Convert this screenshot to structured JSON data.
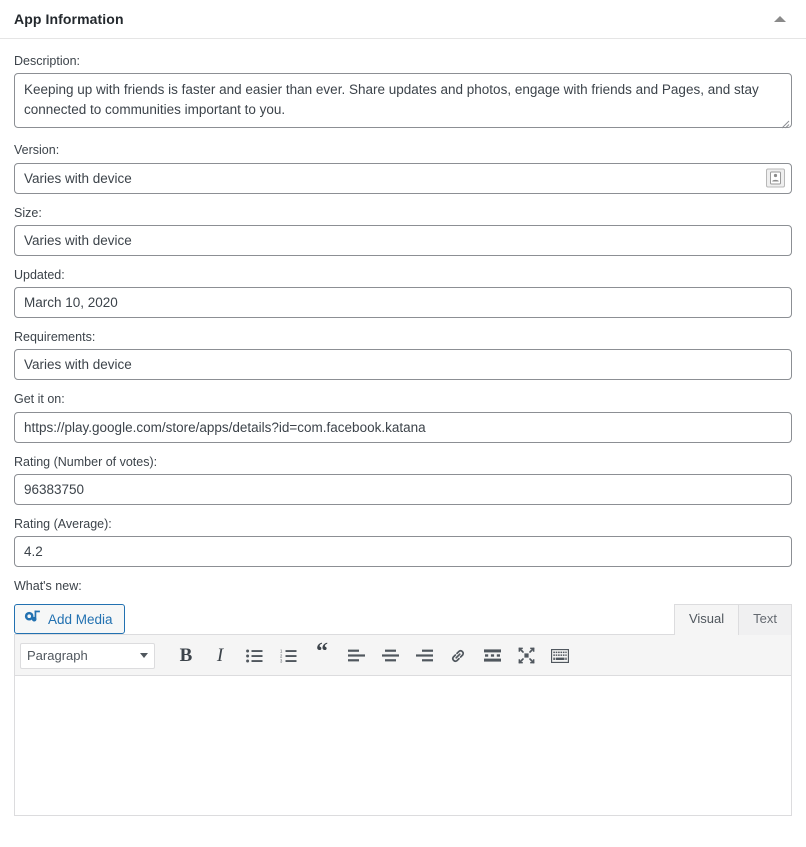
{
  "panel": {
    "title": "App Information",
    "toggle_icon": "caret-up-icon"
  },
  "fields": [
    {
      "key": "description",
      "label": "Description:",
      "type": "textarea",
      "value": "Keeping up with friends is faster and easier than ever. Share updates and photos, engage with friends and Pages, and stay connected to communities important to you."
    },
    {
      "key": "version",
      "label": "Version:",
      "type": "text",
      "value": "Varies with device",
      "trailing_icon": "autofill-card-icon"
    },
    {
      "key": "size",
      "label": "Size:",
      "type": "text",
      "value": "Varies with device"
    },
    {
      "key": "updated",
      "label": "Updated:",
      "type": "text",
      "value": "March 10, 2020"
    },
    {
      "key": "requirements",
      "label": "Requirements:",
      "type": "text",
      "value": "Varies with device"
    },
    {
      "key": "get_it_on",
      "label": "Get it on:",
      "type": "text",
      "value": "https://play.google.com/store/apps/details?id=com.facebook.katana"
    },
    {
      "key": "rating_votes",
      "label": "Rating (Number of votes):",
      "type": "text",
      "value": "96383750"
    },
    {
      "key": "rating_average",
      "label": "Rating (Average):",
      "type": "text",
      "value": "4.2"
    }
  ],
  "editor": {
    "label": "What's new:",
    "add_media_label": "Add Media",
    "add_media_icon": "media-camera-note-icon",
    "tabs": [
      {
        "label": "Visual",
        "active": true
      },
      {
        "label": "Text",
        "active": false
      }
    ],
    "format_select": {
      "value": "Paragraph",
      "caret_icon": "chevron-down-icon"
    },
    "toolbar_buttons": [
      {
        "name": "bold-button",
        "glyph": "B",
        "icon": "bold-icon"
      },
      {
        "name": "italic-button",
        "glyph": "I",
        "icon": "italic-icon"
      },
      {
        "name": "bulleted-list-button",
        "glyph": "",
        "icon": "bulleted-list-icon"
      },
      {
        "name": "numbered-list-button",
        "glyph": "",
        "icon": "numbered-list-icon"
      },
      {
        "name": "blockquote-button",
        "glyph": "“",
        "icon": "blockquote-icon"
      },
      {
        "name": "align-left-button",
        "glyph": "",
        "icon": "align-left-icon"
      },
      {
        "name": "align-center-button",
        "glyph": "",
        "icon": "align-center-icon"
      },
      {
        "name": "align-right-button",
        "glyph": "",
        "icon": "align-right-icon"
      },
      {
        "name": "insert-link-button",
        "glyph": "",
        "icon": "link-icon"
      },
      {
        "name": "insert-read-more-button",
        "glyph": "",
        "icon": "read-more-icon"
      },
      {
        "name": "fullscreen-button",
        "glyph": "",
        "icon": "fullscreen-icon"
      },
      {
        "name": "toolbar-toggle-button",
        "glyph": "",
        "icon": "keyboard-toolbar-icon"
      }
    ],
    "content": ""
  },
  "colors": {
    "accent": "#2271b1",
    "text": "#3c434a",
    "title": "#23282d",
    "border": "#8c8f94",
    "panel_border": "#dcdcde",
    "toolbar_bg": "#f5f5f5"
  }
}
